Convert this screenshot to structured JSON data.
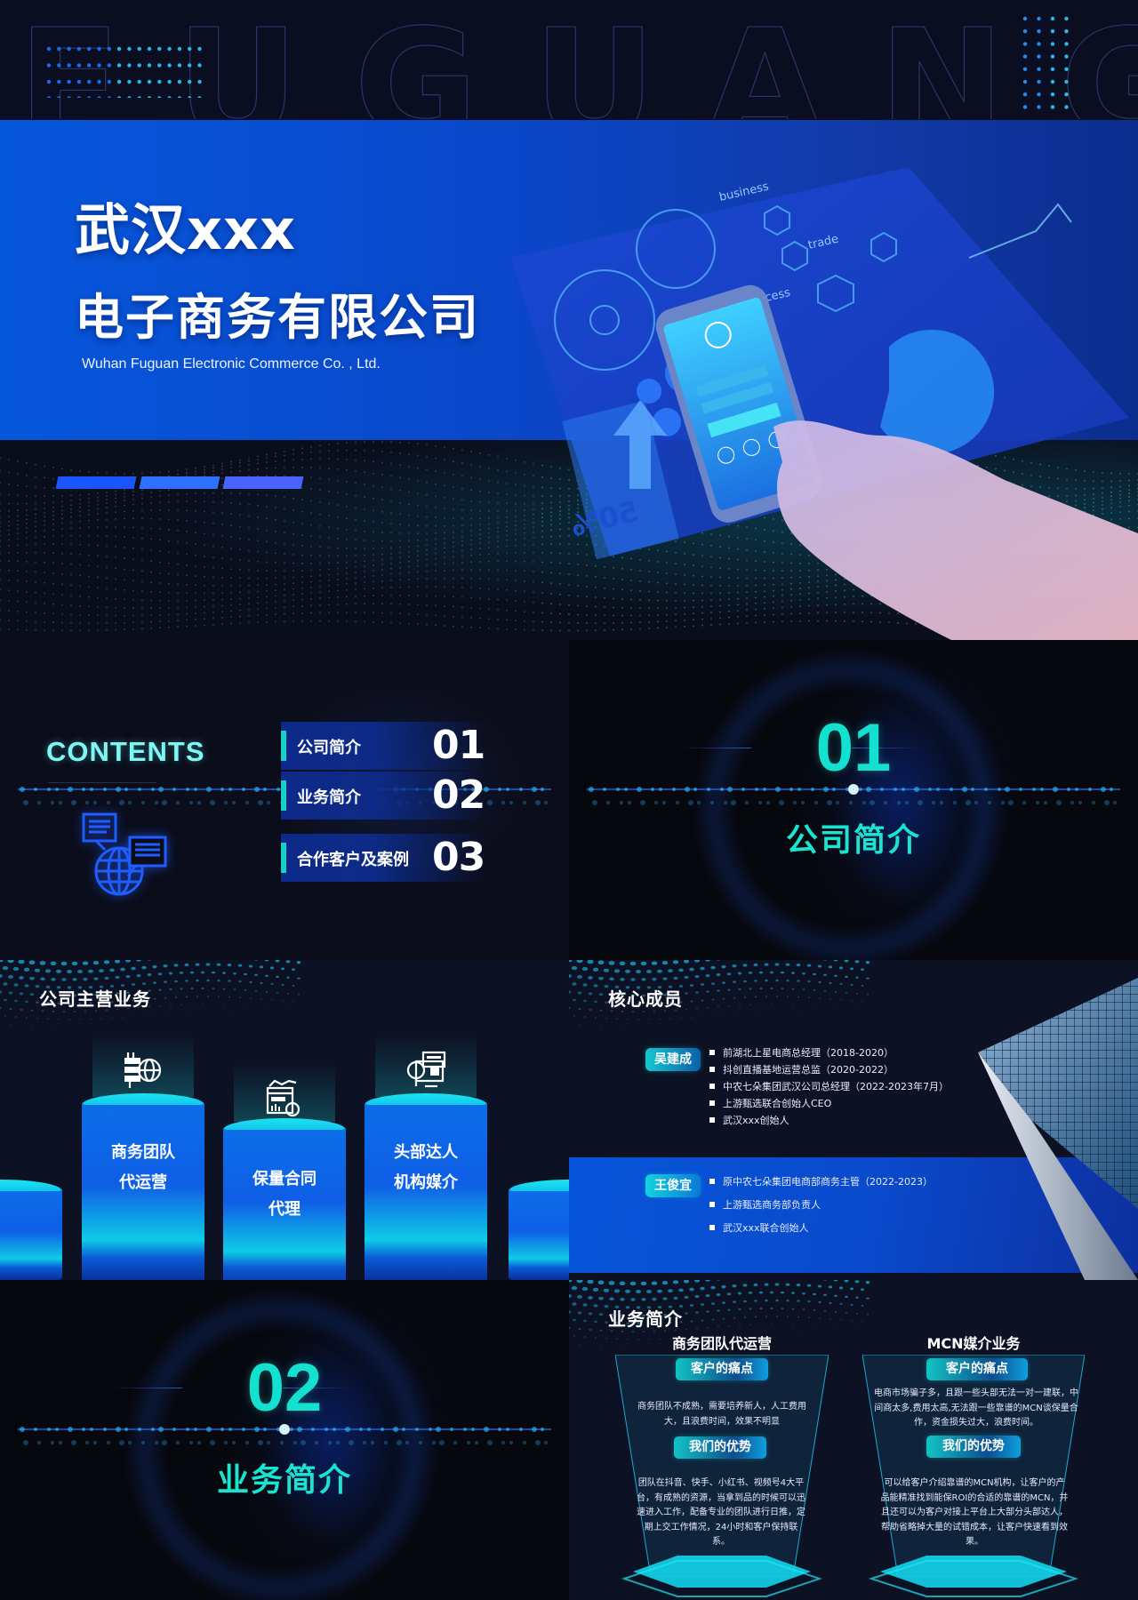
{
  "cover": {
    "watermark": "FUGUANG",
    "title_line1": "武汉xxx",
    "title_line2": "电子商务有限公司",
    "subtitle": "Wuhan Fuguan Electronic Commerce Co. , Ltd.",
    "hero_image": "hand-holding-smartphone-with-business-dashboard",
    "hero_labels": [
      "business",
      "trade",
      "success",
      "50%"
    ],
    "colors": {
      "band": "#0656db",
      "bar1": "#1a56ff",
      "bar2": "#2f70ff",
      "bar3": "#4a63ff"
    }
  },
  "contents": {
    "heading": "CONTENTS",
    "icon": "globe-chat-icon",
    "items": [
      {
        "label": "公司简介",
        "num": "01"
      },
      {
        "label": "业务简介",
        "num": "02"
      },
      {
        "label": "合作客户及案例",
        "num": "03"
      }
    ],
    "accent_color": "#17d1c8"
  },
  "section01": {
    "num": "01",
    "title": "公司简介",
    "color": "#14e0cf"
  },
  "main_business": {
    "heading": "公司主营业务",
    "pillars": [
      {
        "line1": "商务团队",
        "line2": "代运营",
        "icon": "server-globe-icon"
      },
      {
        "line1": "保量合同",
        "line2": "代理",
        "icon": "web-analytics-alert-icon"
      },
      {
        "line1": "头部达人",
        "line2": "机构媒介",
        "icon": "code-search-monitor-icon"
      }
    ]
  },
  "core_members": {
    "heading": "核心成员",
    "members": [
      {
        "name": "吴建成",
        "roles": [
          "前湖北上星电商总经理（2018-2020）",
          "抖创直播基地运营总监（2020-2022）",
          "中农七朵集团武汉公司总经理（2022-2023年7月）",
          "上游甄选联合创始人CEO",
          "武汉xxx创始人"
        ]
      },
      {
        "name": "王俊宜",
        "roles": [
          "原中农七朵集团电商部商务主管（2022-2023）",
          "上游甄选商务部负责人",
          "武汉xxx联合创始人"
        ]
      }
    ]
  },
  "section02": {
    "num": "02",
    "title": "业务简介",
    "color": "#14e0cf"
  },
  "business_intro": {
    "heading": "业务简介",
    "panels": [
      {
        "title": "商务团队代运营",
        "pain_label": "客户的痛点",
        "pain_text": "商务团队不成熟，需要培养新人，人工费用大，且浪费时间，效果不明显",
        "adv_label": "我们的优势",
        "adv_text": "团队在抖音、快手、小红书、视频号4大平台，有成熟的资源，当拿到品的时候可以迅速进入工作，配备专业的团队进行日推，定期上交工作情况，24小时和客户保持联系。"
      },
      {
        "title": "MCN媒介业务",
        "pain_label": "客户的痛点",
        "pain_text": "电商市场骗子多，且跟一些头部无法一对一建联，中间商太多,费用太高,无法跟一些靠谱的MCN谈保量合作，资金损失过大，浪费时间。",
        "adv_label": "我们的优势",
        "adv_text": "可以给客户介绍靠谱的MCN机构，让客户的产品能精准找到能保ROI的合适的靠谱的MCN，并且还可以为客户对接上平台上大部分头部达人，帮助省略掉大量的试错成本，让客户快速看到效果。"
      }
    ]
  }
}
